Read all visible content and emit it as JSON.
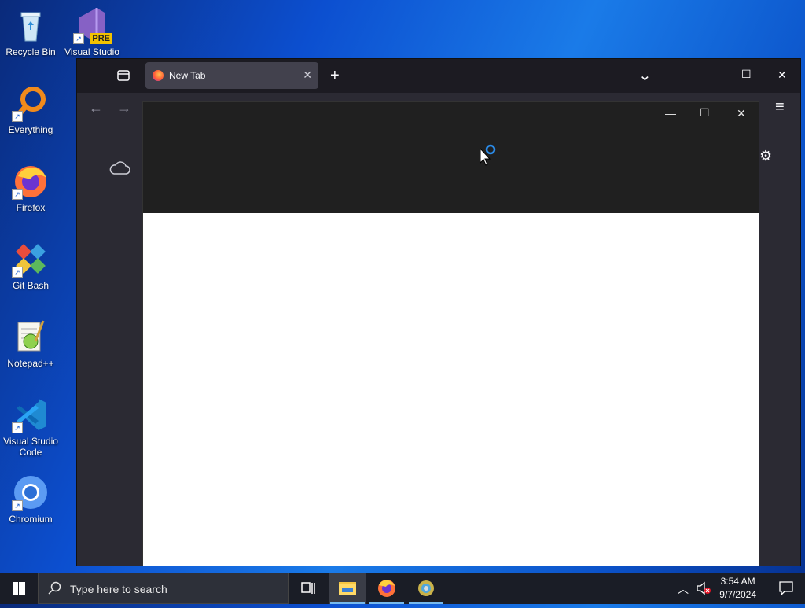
{
  "desktop": {
    "icons": [
      {
        "label": "Recycle Bin",
        "name": "recycle-bin-icon"
      },
      {
        "label": "Visual Studio 20...",
        "name": "visual-studio-icon",
        "badge": "PRE"
      },
      {
        "label": "Everything",
        "name": "everything-icon"
      },
      {
        "label": "Firefox",
        "name": "firefox-icon"
      },
      {
        "label": "Git Bash",
        "name": "git-bash-icon"
      },
      {
        "label": "Notepad++",
        "name": "notepad-plus-plus-icon"
      },
      {
        "label": "Visual Studio Code",
        "name": "vscode-icon"
      },
      {
        "label": "Chromium",
        "name": "chromium-icon"
      }
    ]
  },
  "browser": {
    "tab": {
      "title": "New Tab",
      "close": "✕"
    },
    "new_tab": "+",
    "list_all_tabs": "⌄",
    "minimize": "—",
    "maximize": "☐",
    "close": "✕",
    "back": "←",
    "forward": "→",
    "menu": "≡",
    "settings": "⚙"
  },
  "popup": {
    "minimize": "—",
    "maximize": "☐",
    "close": "✕"
  },
  "taskbar": {
    "search_placeholder": "Type here to search",
    "time": "3:54 AM",
    "date": "9/7/2024"
  },
  "colors": {
    "accent": "#76b9ed",
    "taskbar": "#1a1d26",
    "browser_chrome": "#1c1b22"
  }
}
